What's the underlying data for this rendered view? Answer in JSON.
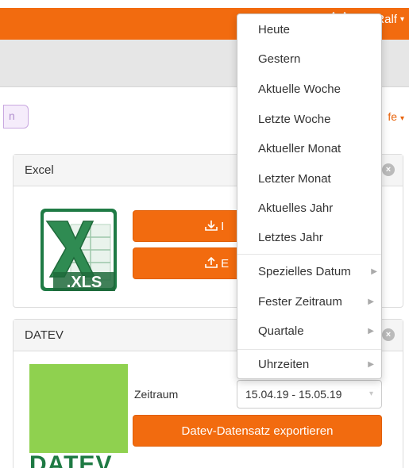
{
  "header": {
    "user_name": "Ralf",
    "user_caret": "▾"
  },
  "filter": {
    "left_pill_text": "n",
    "right_text": "fe",
    "right_caret": "▾"
  },
  "excel_panel": {
    "title": "Excel",
    "close_glyph": "×",
    "logo_text": ".XLS",
    "import_label": "I",
    "import_icon": "download-icon",
    "export_label": "E",
    "export_icon": "upload-icon"
  },
  "datev_panel": {
    "title": "DATEV",
    "close_glyph": "×",
    "logo_word": "DATEV",
    "zeitraum_label": "Zeitraum",
    "zeitraum_value": "15.04.19 - 15.05.19",
    "zeitraum_caret": "▾",
    "export_button": "Datev-Datensatz exportieren"
  },
  "dropdown": {
    "items": [
      {
        "label": "Heute"
      },
      {
        "label": "Gestern"
      },
      {
        "label": "Aktuelle Woche"
      },
      {
        "label": "Letzte Woche"
      },
      {
        "label": "Aktueller Monat"
      },
      {
        "label": "Letzter Monat"
      },
      {
        "label": "Aktuelles Jahr"
      },
      {
        "label": "Letztes Jahr"
      },
      {
        "label": "Spezielles Datum",
        "submenu": true
      },
      {
        "label": "Fester Zeitraum",
        "submenu": true
      },
      {
        "label": "Quartale",
        "submenu": true
      },
      {
        "label": "Uhrzeiten",
        "submenu": true
      }
    ],
    "submenu_arrow": "▶"
  },
  "colors": {
    "brand_orange": "#f26b0f",
    "datev_green": "#8fd14f",
    "datev_dark_green": "#1e7a43",
    "excel_green": "#1f7b45"
  }
}
